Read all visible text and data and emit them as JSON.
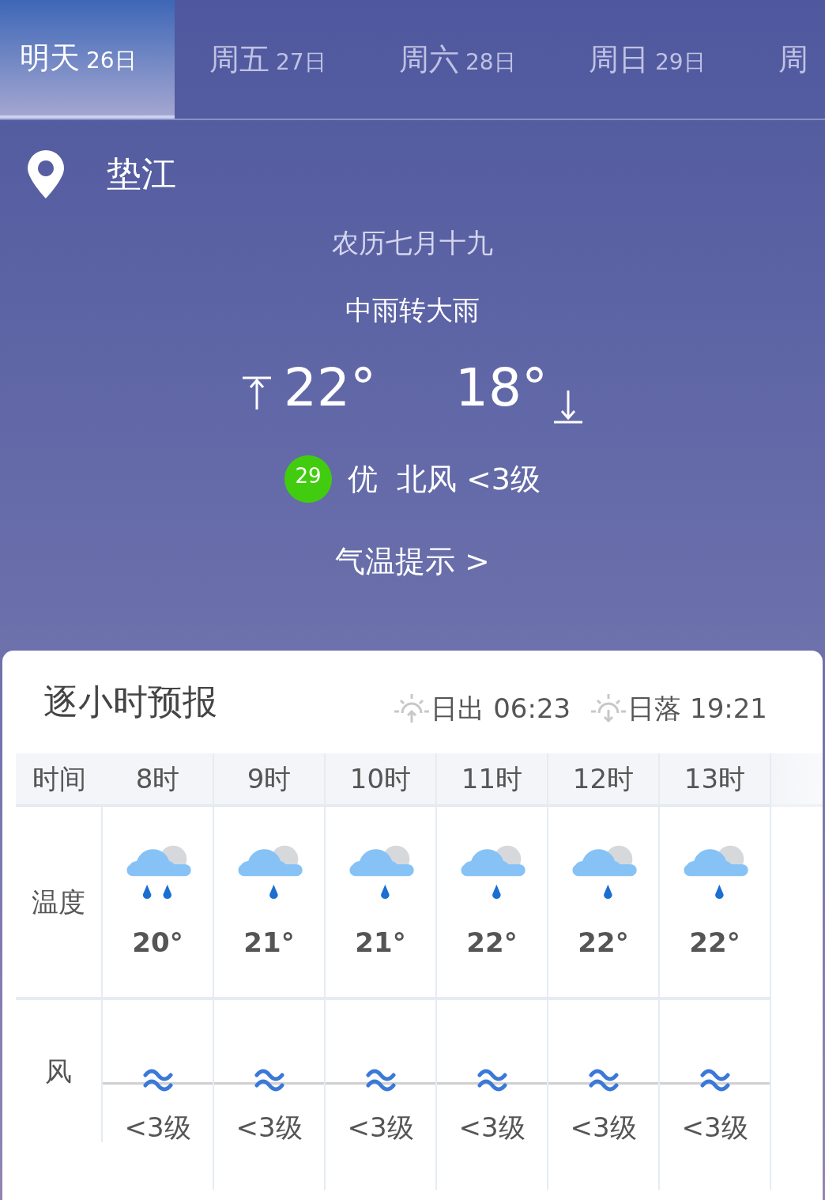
{
  "tabs": [
    {
      "day": "明天",
      "date": "26日",
      "selected": true
    },
    {
      "day": "周五",
      "date": "27日",
      "selected": false
    },
    {
      "day": "周六",
      "date": "28日",
      "selected": false
    },
    {
      "day": "周日",
      "date": "29日",
      "selected": false
    },
    {
      "day": "周",
      "selected": false
    }
  ],
  "location": "垫江",
  "lunar_date": "农历七月十九",
  "weather": "中雨转大雨",
  "high": "22°",
  "low": "18°",
  "aqi": {
    "value": "29",
    "level": "优"
  },
  "wind": "北风 <3级",
  "tips_link": "气温提示 >",
  "hourly": {
    "title": "逐小时预报",
    "sunrise": {
      "label": "日出",
      "time": "06:23"
    },
    "sunset": {
      "label": "日落",
      "time": "19:21"
    },
    "row_labels": {
      "time": "时间",
      "temperature": "温度",
      "wind": "风"
    },
    "hours": [
      {
        "time": "8时",
        "kind": "heavy_rain",
        "temperature": "20°",
        "wind": "<3级"
      },
      {
        "time": "9时",
        "kind": "light_rain",
        "temperature": "21°",
        "wind": "<3级"
      },
      {
        "time": "10时",
        "kind": "light_rain",
        "temperature": "21°",
        "wind": "<3级"
      },
      {
        "time": "11时",
        "kind": "light_rain",
        "temperature": "22°",
        "wind": "<3级"
      },
      {
        "time": "12时",
        "kind": "light_rain",
        "temperature": "22°",
        "wind": "<3级"
      },
      {
        "time": "13时",
        "kind": "light_rain",
        "temperature": "22°",
        "wind": "<3级"
      }
    ]
  }
}
